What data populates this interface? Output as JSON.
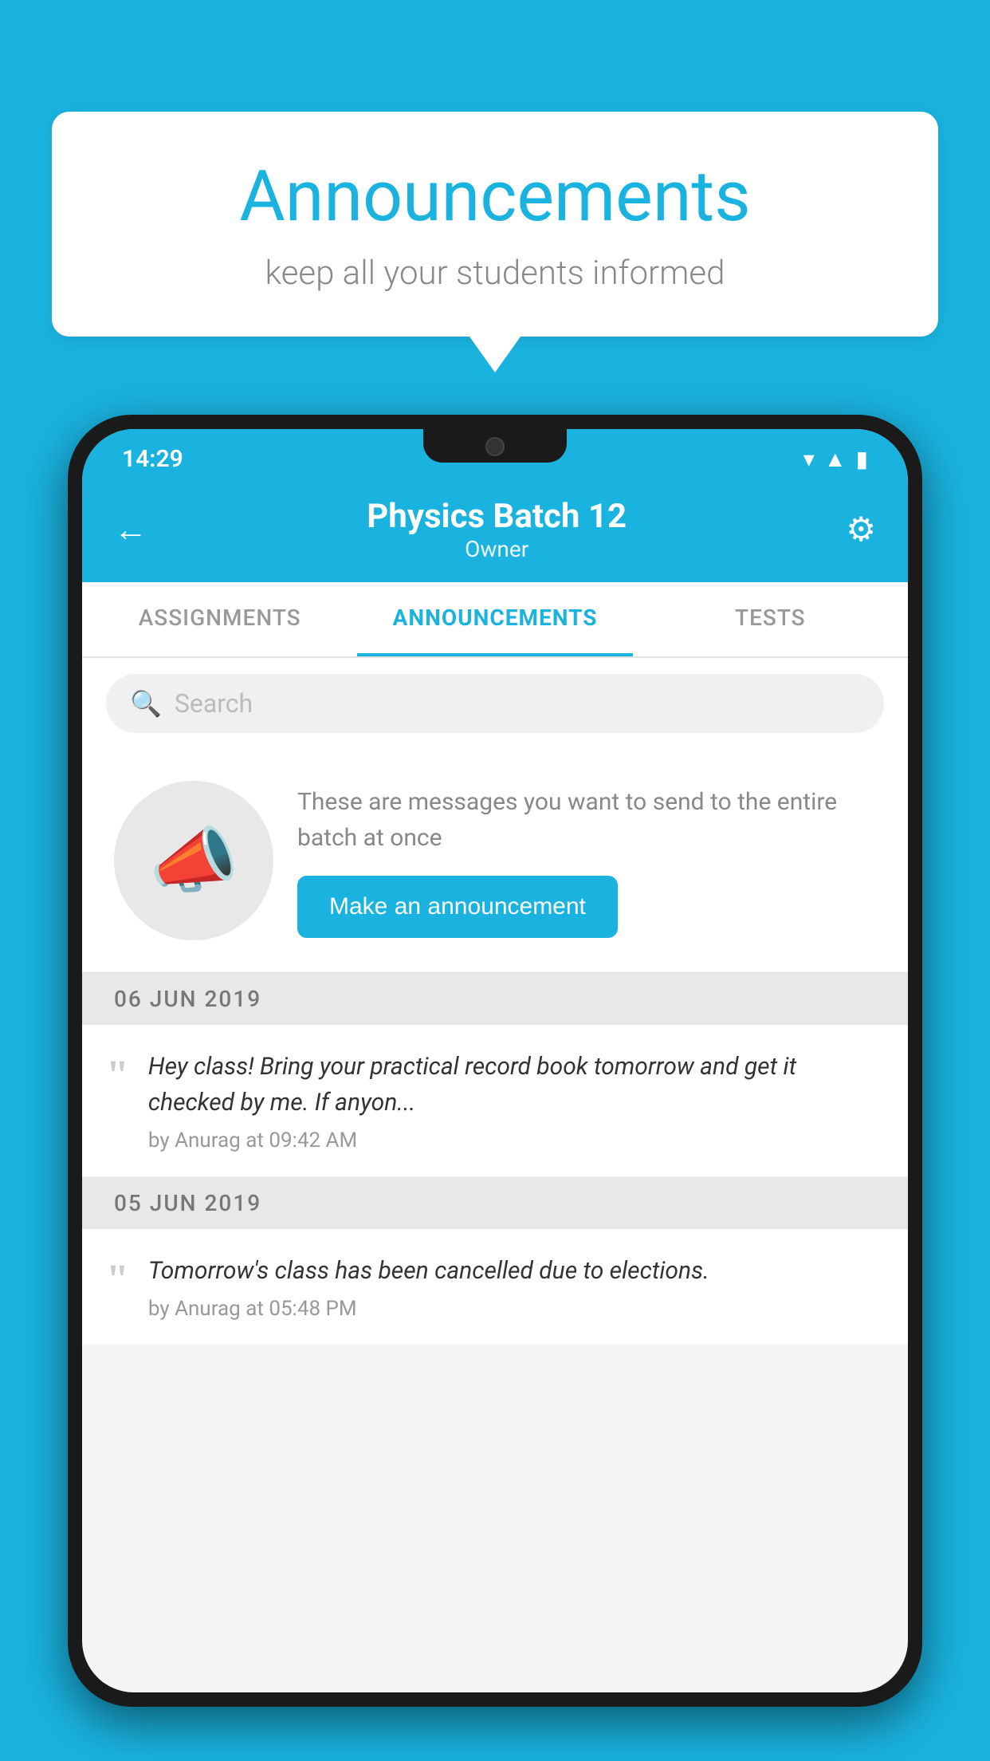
{
  "background": {
    "color": "#1ab3e0"
  },
  "speech_bubble": {
    "title": "Announcements",
    "subtitle": "keep all your students informed"
  },
  "phone": {
    "status_bar": {
      "time": "14:29"
    },
    "header": {
      "title": "Physics Batch 12",
      "subtitle": "Owner",
      "back_label": "←",
      "settings_label": "⚙"
    },
    "tabs": [
      {
        "label": "ASSIGNMENTS",
        "active": false
      },
      {
        "label": "ANNOUNCEMENTS",
        "active": true
      },
      {
        "label": "TESTS",
        "active": false
      }
    ],
    "search": {
      "placeholder": "Search"
    },
    "promo": {
      "text": "These are messages you want to send to the entire batch at once",
      "button_label": "Make an announcement"
    },
    "announcements": [
      {
        "date": "06  JUN  2019",
        "text": "Hey class! Bring your practical record book tomorrow and get it checked by me. If anyon...",
        "meta": "by Anurag at 09:42 AM"
      },
      {
        "date": "05  JUN  2019",
        "text": "Tomorrow's class has been cancelled due to elections.",
        "meta": "by Anurag at 05:48 PM"
      }
    ]
  }
}
